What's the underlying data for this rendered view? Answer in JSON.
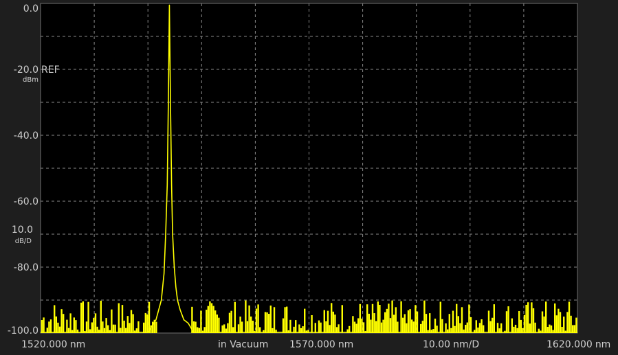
{
  "chart_data": {
    "type": "line",
    "title": "",
    "xlabel": "",
    "ylabel": "",
    "x_unit": "nm",
    "y_unit": "dBm",
    "xlim": [
      1520.0,
      1620.0
    ],
    "ylim": [
      -100.0,
      0.0
    ],
    "x_divisions": 10,
    "y_divisions": 10,
    "grid": true,
    "legend": "none",
    "trace_color": "#ffff00",
    "series": [
      {
        "x": [
          1520.0,
          1540.0,
          1541.5,
          1542.5,
          1543.0,
          1543.3,
          1543.6,
          1543.8,
          1544.0,
          1544.2,
          1544.4,
          1544.6,
          1544.9,
          1545.2,
          1545.5,
          1546.0,
          1546.7,
          1547.5,
          1548.5,
          1620.0
        ],
        "y": [
          -99.8,
          -99.8,
          -96.0,
          -90.0,
          -82.0,
          -70.0,
          -55.0,
          -30.0,
          -0.5,
          -30.0,
          -55.0,
          -70.0,
          -80.0,
          -86.0,
          -90.0,
          -93.0,
          -96.0,
          -97.0,
          -99.8,
          -99.8
        ]
      }
    ],
    "noise_floor": [
      -100.0,
      -90.0
    ],
    "y_ticks": [
      {
        "label": "0.0",
        "value": 0.0
      },
      {
        "label": "-20.0",
        "value": -20.0
      },
      {
        "label": "-40.0",
        "value": -40.0
      },
      {
        "label": "-60.0",
        "value": -60.0
      },
      {
        "label": "-80.0",
        "value": -80.0
      },
      {
        "label": "-100.0",
        "value": -100.0
      }
    ],
    "ref_level": {
      "value": "-20.0",
      "label": "REF",
      "unit": "dBm"
    },
    "scale": {
      "value": "10.0",
      "unit": "dB/D",
      "at": -70.0
    },
    "footer": {
      "start": {
        "value": "1520.000",
        "unit": "nm"
      },
      "medium": "in Vacuum",
      "center": {
        "value": "1570.000",
        "unit": "nm"
      },
      "span_per_div": {
        "value": "10.00",
        "unit": "nm/D"
      },
      "stop": {
        "value": "1620.000",
        "unit": "nm"
      }
    }
  }
}
